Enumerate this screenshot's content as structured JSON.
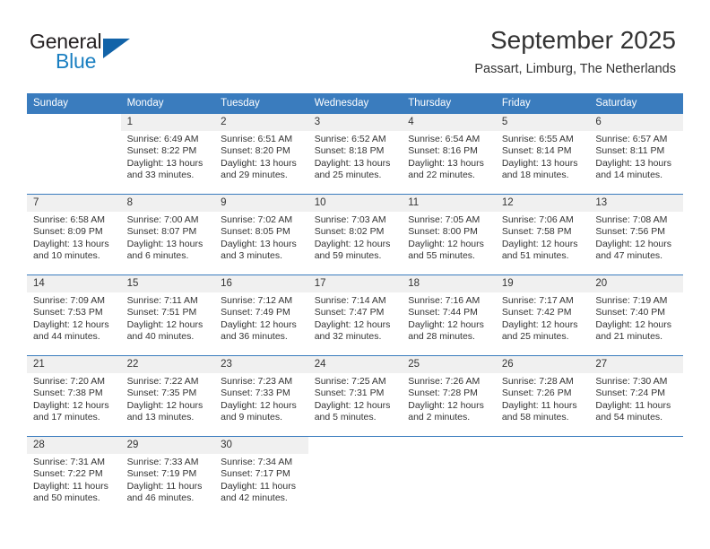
{
  "brand": {
    "name_part1": "General",
    "name_part2": "Blue",
    "accent_color": "#1263a8",
    "text_color": "#231f20"
  },
  "header": {
    "title": "September 2025",
    "location": "Passart, Limburg, The Netherlands"
  },
  "theme": {
    "header_row_color": "#3a7cbe",
    "daynum_bg": "#f0f0f0",
    "text_color": "#333333"
  },
  "calendar": {
    "weekday_headers": [
      "Sunday",
      "Monday",
      "Tuesday",
      "Wednesday",
      "Thursday",
      "Friday",
      "Saturday"
    ],
    "weeks": [
      [
        {
          "day": "",
          "blank": true
        },
        {
          "day": "1",
          "sunrise": "Sunrise: 6:49 AM",
          "sunset": "Sunset: 8:22 PM",
          "daylight1": "Daylight: 13 hours",
          "daylight2": "and 33 minutes."
        },
        {
          "day": "2",
          "sunrise": "Sunrise: 6:51 AM",
          "sunset": "Sunset: 8:20 PM",
          "daylight1": "Daylight: 13 hours",
          "daylight2": "and 29 minutes."
        },
        {
          "day": "3",
          "sunrise": "Sunrise: 6:52 AM",
          "sunset": "Sunset: 8:18 PM",
          "daylight1": "Daylight: 13 hours",
          "daylight2": "and 25 minutes."
        },
        {
          "day": "4",
          "sunrise": "Sunrise: 6:54 AM",
          "sunset": "Sunset: 8:16 PM",
          "daylight1": "Daylight: 13 hours",
          "daylight2": "and 22 minutes."
        },
        {
          "day": "5",
          "sunrise": "Sunrise: 6:55 AM",
          "sunset": "Sunset: 8:14 PM",
          "daylight1": "Daylight: 13 hours",
          "daylight2": "and 18 minutes."
        },
        {
          "day": "6",
          "sunrise": "Sunrise: 6:57 AM",
          "sunset": "Sunset: 8:11 PM",
          "daylight1": "Daylight: 13 hours",
          "daylight2": "and 14 minutes."
        }
      ],
      [
        {
          "day": "7",
          "sunrise": "Sunrise: 6:58 AM",
          "sunset": "Sunset: 8:09 PM",
          "daylight1": "Daylight: 13 hours",
          "daylight2": "and 10 minutes."
        },
        {
          "day": "8",
          "sunrise": "Sunrise: 7:00 AM",
          "sunset": "Sunset: 8:07 PM",
          "daylight1": "Daylight: 13 hours",
          "daylight2": "and 6 minutes."
        },
        {
          "day": "9",
          "sunrise": "Sunrise: 7:02 AM",
          "sunset": "Sunset: 8:05 PM",
          "daylight1": "Daylight: 13 hours",
          "daylight2": "and 3 minutes."
        },
        {
          "day": "10",
          "sunrise": "Sunrise: 7:03 AM",
          "sunset": "Sunset: 8:02 PM",
          "daylight1": "Daylight: 12 hours",
          "daylight2": "and 59 minutes."
        },
        {
          "day": "11",
          "sunrise": "Sunrise: 7:05 AM",
          "sunset": "Sunset: 8:00 PM",
          "daylight1": "Daylight: 12 hours",
          "daylight2": "and 55 minutes."
        },
        {
          "day": "12",
          "sunrise": "Sunrise: 7:06 AM",
          "sunset": "Sunset: 7:58 PM",
          "daylight1": "Daylight: 12 hours",
          "daylight2": "and 51 minutes."
        },
        {
          "day": "13",
          "sunrise": "Sunrise: 7:08 AM",
          "sunset": "Sunset: 7:56 PM",
          "daylight1": "Daylight: 12 hours",
          "daylight2": "and 47 minutes."
        }
      ],
      [
        {
          "day": "14",
          "sunrise": "Sunrise: 7:09 AM",
          "sunset": "Sunset: 7:53 PM",
          "daylight1": "Daylight: 12 hours",
          "daylight2": "and 44 minutes."
        },
        {
          "day": "15",
          "sunrise": "Sunrise: 7:11 AM",
          "sunset": "Sunset: 7:51 PM",
          "daylight1": "Daylight: 12 hours",
          "daylight2": "and 40 minutes."
        },
        {
          "day": "16",
          "sunrise": "Sunrise: 7:12 AM",
          "sunset": "Sunset: 7:49 PM",
          "daylight1": "Daylight: 12 hours",
          "daylight2": "and 36 minutes."
        },
        {
          "day": "17",
          "sunrise": "Sunrise: 7:14 AM",
          "sunset": "Sunset: 7:47 PM",
          "daylight1": "Daylight: 12 hours",
          "daylight2": "and 32 minutes."
        },
        {
          "day": "18",
          "sunrise": "Sunrise: 7:16 AM",
          "sunset": "Sunset: 7:44 PM",
          "daylight1": "Daylight: 12 hours",
          "daylight2": "and 28 minutes."
        },
        {
          "day": "19",
          "sunrise": "Sunrise: 7:17 AM",
          "sunset": "Sunset: 7:42 PM",
          "daylight1": "Daylight: 12 hours",
          "daylight2": "and 25 minutes."
        },
        {
          "day": "20",
          "sunrise": "Sunrise: 7:19 AM",
          "sunset": "Sunset: 7:40 PM",
          "daylight1": "Daylight: 12 hours",
          "daylight2": "and 21 minutes."
        }
      ],
      [
        {
          "day": "21",
          "sunrise": "Sunrise: 7:20 AM",
          "sunset": "Sunset: 7:38 PM",
          "daylight1": "Daylight: 12 hours",
          "daylight2": "and 17 minutes."
        },
        {
          "day": "22",
          "sunrise": "Sunrise: 7:22 AM",
          "sunset": "Sunset: 7:35 PM",
          "daylight1": "Daylight: 12 hours",
          "daylight2": "and 13 minutes."
        },
        {
          "day": "23",
          "sunrise": "Sunrise: 7:23 AM",
          "sunset": "Sunset: 7:33 PM",
          "daylight1": "Daylight: 12 hours",
          "daylight2": "and 9 minutes."
        },
        {
          "day": "24",
          "sunrise": "Sunrise: 7:25 AM",
          "sunset": "Sunset: 7:31 PM",
          "daylight1": "Daylight: 12 hours",
          "daylight2": "and 5 minutes."
        },
        {
          "day": "25",
          "sunrise": "Sunrise: 7:26 AM",
          "sunset": "Sunset: 7:28 PM",
          "daylight1": "Daylight: 12 hours",
          "daylight2": "and 2 minutes."
        },
        {
          "day": "26",
          "sunrise": "Sunrise: 7:28 AM",
          "sunset": "Sunset: 7:26 PM",
          "daylight1": "Daylight: 11 hours",
          "daylight2": "and 58 minutes."
        },
        {
          "day": "27",
          "sunrise": "Sunrise: 7:30 AM",
          "sunset": "Sunset: 7:24 PM",
          "daylight1": "Daylight: 11 hours",
          "daylight2": "and 54 minutes."
        }
      ],
      [
        {
          "day": "28",
          "sunrise": "Sunrise: 7:31 AM",
          "sunset": "Sunset: 7:22 PM",
          "daylight1": "Daylight: 11 hours",
          "daylight2": "and 50 minutes."
        },
        {
          "day": "29",
          "sunrise": "Sunrise: 7:33 AM",
          "sunset": "Sunset: 7:19 PM",
          "daylight1": "Daylight: 11 hours",
          "daylight2": "and 46 minutes."
        },
        {
          "day": "30",
          "sunrise": "Sunrise: 7:34 AM",
          "sunset": "Sunset: 7:17 PM",
          "daylight1": "Daylight: 11 hours",
          "daylight2": "and 42 minutes."
        },
        {
          "day": "",
          "blank": true
        },
        {
          "day": "",
          "blank": true
        },
        {
          "day": "",
          "blank": true
        },
        {
          "day": "",
          "blank": true
        }
      ]
    ]
  }
}
